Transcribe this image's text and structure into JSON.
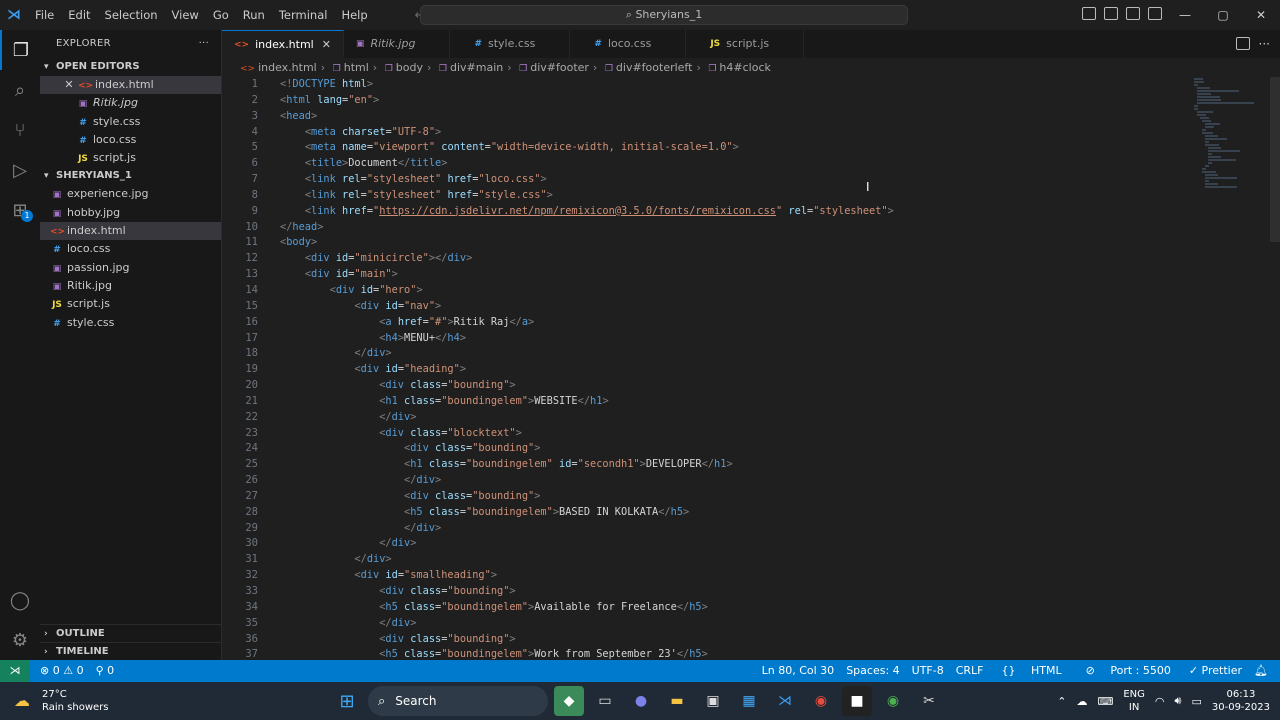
{
  "titlebar": {
    "menu": [
      "File",
      "Edit",
      "Selection",
      "View",
      "Go",
      "Run",
      "Terminal",
      "Help"
    ],
    "search": "Sheryians_1"
  },
  "sidebar": {
    "explorer_label": "EXPLORER",
    "open_editors_label": "OPEN EDITORS",
    "open_editors": [
      {
        "name": "index.html",
        "type": "html",
        "icon": "<>"
      },
      {
        "name": "Ritik.jpg",
        "type": "img",
        "icon": "▣"
      },
      {
        "name": "style.css",
        "type": "css",
        "icon": "#"
      },
      {
        "name": "loco.css",
        "type": "css",
        "icon": "#"
      },
      {
        "name": "script.js",
        "type": "js",
        "icon": "JS"
      }
    ],
    "folder_label": "SHERYIANS_1",
    "files": [
      {
        "name": "experience.jpg",
        "type": "img",
        "icon": "▣"
      },
      {
        "name": "hobby.jpg",
        "type": "img",
        "icon": "▣"
      },
      {
        "name": "index.html",
        "type": "html",
        "icon": "<>"
      },
      {
        "name": "loco.css",
        "type": "css",
        "icon": "#"
      },
      {
        "name": "passion.jpg",
        "type": "img",
        "icon": "▣"
      },
      {
        "name": "Ritik.jpg",
        "type": "img",
        "icon": "▣"
      },
      {
        "name": "script.js",
        "type": "js",
        "icon": "JS"
      },
      {
        "name": "style.css",
        "type": "css",
        "icon": "#"
      }
    ],
    "outline_label": "OUTLINE",
    "timeline_label": "TIMELINE"
  },
  "tabs": [
    {
      "name": "index.html",
      "icon": "<>",
      "type": "html"
    },
    {
      "name": "Ritik.jpg",
      "icon": "▣",
      "type": "img"
    },
    {
      "name": "style.css",
      "icon": "#",
      "type": "css"
    },
    {
      "name": "loco.css",
      "icon": "#",
      "type": "css"
    },
    {
      "name": "script.js",
      "icon": "JS",
      "type": "js"
    }
  ],
  "breadcrumb": [
    "index.html",
    "html",
    "body",
    "div#main",
    "div#footer",
    "div#footerleft",
    "h4#clock"
  ],
  "code_lines": [
    "<!DOCTYPE html>",
    "<html lang=\"en\">",
    "<head>",
    "    <meta charset=\"UTF-8\">",
    "    <meta name=\"viewport\" content=\"width=device-width, initial-scale=1.0\">",
    "    <title>Document</title>",
    "    <link rel=\"stylesheet\" href=\"loco.css\">",
    "    <link rel=\"stylesheet\" href=\"style.css\">",
    "    <link href=\"https://cdn.jsdelivr.net/npm/remixicon@3.5.0/fonts/remixicon.css\" rel=\"stylesheet\">",
    "</head>",
    "<body>",
    "    <div id=\"minicircle\"></div>",
    "    <div id=\"main\">",
    "        <div id=\"hero\">",
    "            <div id=\"nav\">",
    "                <a href=\"#\">Ritik Raj</a>",
    "                <h4>MENU+</h4>",
    "            </div>",
    "            <div id=\"heading\">",
    "                <div class=\"bounding\">",
    "                <h1 class=\"boundingelem\">WEBSITE</h1>",
    "                </div>",
    "                <div class=\"blocktext\">",
    "                    <div class=\"bounding\">",
    "                    <h1 class=\"boundingelem\" id=\"secondh1\">DEVELOPER</h1>",
    "                    </div>",
    "                    <div class=\"bounding\">",
    "                    <h5 class=\"boundingelem\">BASED IN KOLKATA</h5>",
    "                    </div>",
    "                </div>",
    "            </div>",
    "            <div id=\"smallheading\">",
    "                <div class=\"bounding\">",
    "                <h5 class=\"boundingelem\">Available for Freelance</h5>",
    "                </div>",
    "                <div class=\"bounding\">",
    "                <h5 class=\"boundingelem\">Work from September 23'</h5>"
  ],
  "statusbar": {
    "errors": "⊗ 0 ⚠ 0",
    "ports": "⚲ 0",
    "position": "Ln 80, Col 30",
    "spaces": "Spaces: 4",
    "encoding": "UTF-8",
    "eol": "CRLF",
    "language": "HTML",
    "port": "Port : 5500",
    "prettier": "✓ Prettier"
  },
  "taskbar": {
    "temp": "27°C",
    "weather": "Rain showers",
    "search": "Search",
    "lang1": "ENG",
    "lang2": "IN",
    "time": "06:13",
    "date": "30-09-2023"
  }
}
